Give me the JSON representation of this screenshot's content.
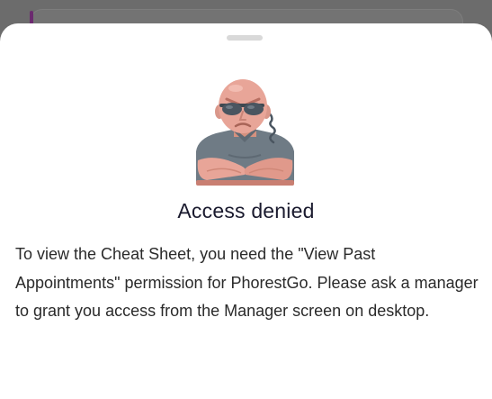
{
  "dialog": {
    "title": "Access denied",
    "message": "To view the Cheat Sheet, you need the \"View Past Appointments\" permission for PhorestGo. Please ask a manager to grant you access from the Manager screen on desktop.",
    "illustration": "bouncer-with-sunglasses-icon"
  },
  "colors": {
    "backdrop": "#6c6c6c",
    "sheet": "#ffffff",
    "handle": "#d9d9d9",
    "title_text": "#1a1a2e",
    "body_text": "#2a2a2a",
    "skin": "#e8a598",
    "shirt": "#6f7b85",
    "glasses": "#4a5560"
  }
}
